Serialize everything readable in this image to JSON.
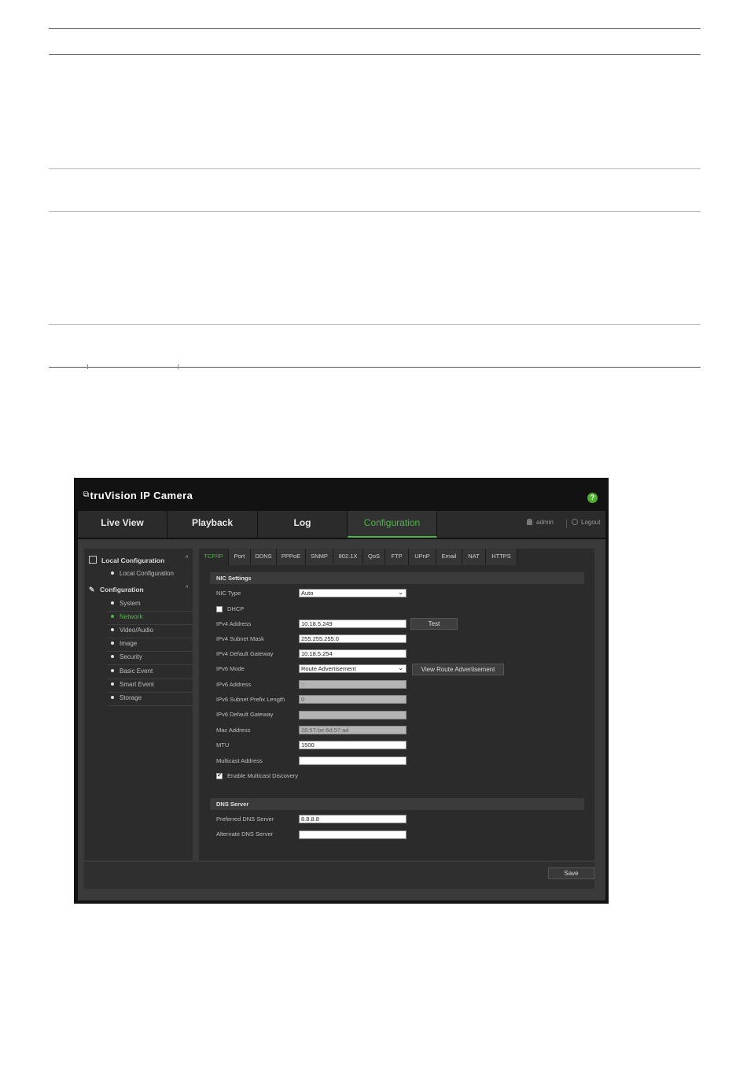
{
  "app": {
    "logo_mark": "⧉",
    "title": "truVision  IP Camera",
    "help_label": "?"
  },
  "topnav": {
    "tabs": [
      {
        "label": "Live View"
      },
      {
        "label": "Playback"
      },
      {
        "label": "Log"
      },
      {
        "label": "Configuration",
        "active": true
      }
    ],
    "user": "admin",
    "logout": "Logout"
  },
  "sidebar": {
    "local_header": "Local Configuration",
    "local_items": [
      {
        "label": "Local Configuration"
      }
    ],
    "config_header": "Configuration",
    "config_items": [
      {
        "label": "System"
      },
      {
        "label": "Network",
        "active": true
      },
      {
        "label": "Video/Audio"
      },
      {
        "label": "Image"
      },
      {
        "label": "Security"
      },
      {
        "label": "Basic Event"
      },
      {
        "label": "Smart Event"
      },
      {
        "label": "Storage"
      }
    ],
    "caret": "^"
  },
  "subtabs": [
    {
      "label": "TCP/IP",
      "active": true
    },
    {
      "label": "Port"
    },
    {
      "label": "DDNS"
    },
    {
      "label": "PPPoE"
    },
    {
      "label": "SNMP"
    },
    {
      "label": "802.1X"
    },
    {
      "label": "QoS"
    },
    {
      "label": "FTP"
    },
    {
      "label": "UPnP"
    },
    {
      "label": "Email"
    },
    {
      "label": "NAT"
    },
    {
      "label": "HTTPS"
    }
  ],
  "nic": {
    "section_title": "NIC Settings",
    "nic_type_label": "NIC Type",
    "nic_type_value": "Auto",
    "dhcp_label": "DHCP",
    "dhcp_checked": false,
    "ipv4_address_label": "IPv4 Address",
    "ipv4_address_value": "10.18.5.249",
    "test_label": "Test",
    "ipv4_mask_label": "IPv4 Subnet Mask",
    "ipv4_mask_value": "255.255.255.0",
    "ipv4_gateway_label": "IPv4 Default Gateway",
    "ipv4_gateway_value": "10.18.5.254",
    "ipv6_mode_label": "IPv6 Mode",
    "ipv6_mode_value": "Route Advertisement",
    "view_route_label": "View Route Advertisement",
    "ipv6_address_label": "IPv6 Address",
    "ipv6_address_value": "::",
    "ipv6_prefix_label": "IPv6 Subnet Prefix Length",
    "ipv6_prefix_value": "0",
    "ipv6_gateway_label": "IPv6 Default Gateway",
    "ipv6_gateway_value": "",
    "mac_label": "Mac Address",
    "mac_value": "28:57:be:6d:57:ad",
    "mtu_label": "MTU",
    "mtu_value": "1500",
    "multicast_label": "Multicast Address",
    "multicast_value": "",
    "multicast_discovery_label": "Enable Multicast Discovery",
    "multicast_discovery_checked": true
  },
  "dns": {
    "section_title": "DNS Server",
    "preferred_label": "Preferred DNS Server",
    "preferred_value": "8.8.8.8",
    "alternate_label": "Alternate DNS Server",
    "alternate_value": ""
  },
  "footer": {
    "save_label": "Save"
  },
  "icons": {
    "check": "✔",
    "chevron": "⌄"
  }
}
